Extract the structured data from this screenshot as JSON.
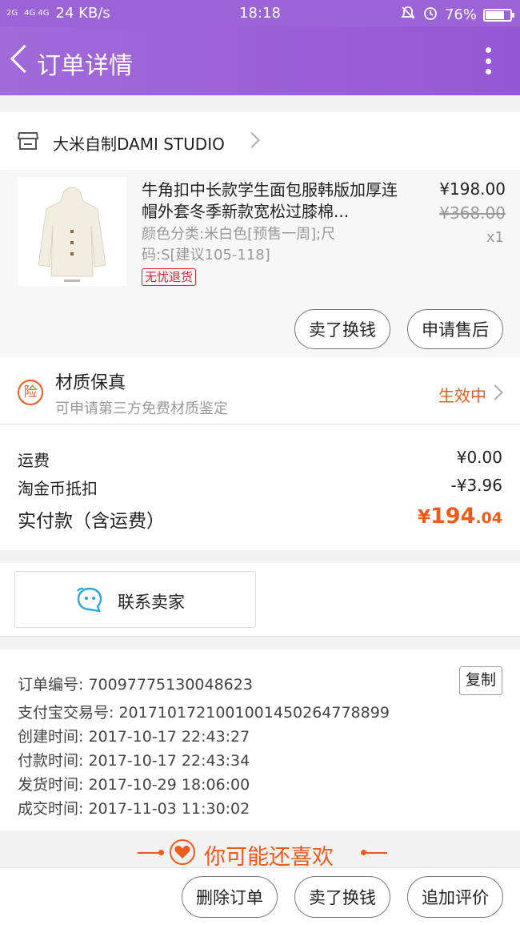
{
  "status_bar": {
    "net_left": "2G",
    "net_right": "4G 4G",
    "speed": "24 KB/s",
    "time": "18:18",
    "battery": "76%",
    "battery_level": 0.76
  },
  "header": {
    "title": "订单详情"
  },
  "shop": {
    "name": "大米自制DAMI STUDIO"
  },
  "product": {
    "title": "牛角扣中长款学生面包服韩版加厚连帽外套冬季新款宽松过膝棉...",
    "spec": "颜色分类:米白色[预售一周];尺码:S[建议105-118]",
    "badge": "无忧退货",
    "price": "¥198.00",
    "original_price": "¥368.00",
    "quantity": "x1",
    "sell_btn": "卖了换钱",
    "after_sale_btn": "申请售后"
  },
  "insurance": {
    "icon_char": "险",
    "title": "材质保真",
    "subtitle": "可申请第三方免费材质鉴定",
    "status": "生效中"
  },
  "fees": {
    "shipping_label": "运费",
    "shipping_value": "¥0.00",
    "coin_label": "淘金币抵扣",
    "coin_value": "-¥3.96",
    "total_label": "实付款（含运费）",
    "total_currency": "¥",
    "total_int": "194",
    "total_dec": ".04"
  },
  "contact": {
    "label": "联系卖家"
  },
  "order_info": {
    "order_no": "订单编号: 70097775130048623",
    "copy_btn": "复制",
    "alipay_no": "支付宝交易号: 2017101721001001450264778899",
    "created": "创建时间: 2017-10-17 22:43:27",
    "paid": "付款时间: 2017-10-17 22:43:34",
    "shipped": "发货时间: 2017-10-29 18:06:00",
    "completed": "成交时间: 2017-11-03 11:30:02"
  },
  "recommend": {
    "text": "你可能还喜欢"
  },
  "bottom_bar": {
    "delete_btn": "删除订单",
    "sell_btn": "卖了换钱",
    "review_btn": "追加评价"
  },
  "colors": {
    "header": "#9b63d6",
    "accent": "#f05a1c",
    "badge": "#e0232f",
    "contact_icon": "#29a8e0"
  }
}
